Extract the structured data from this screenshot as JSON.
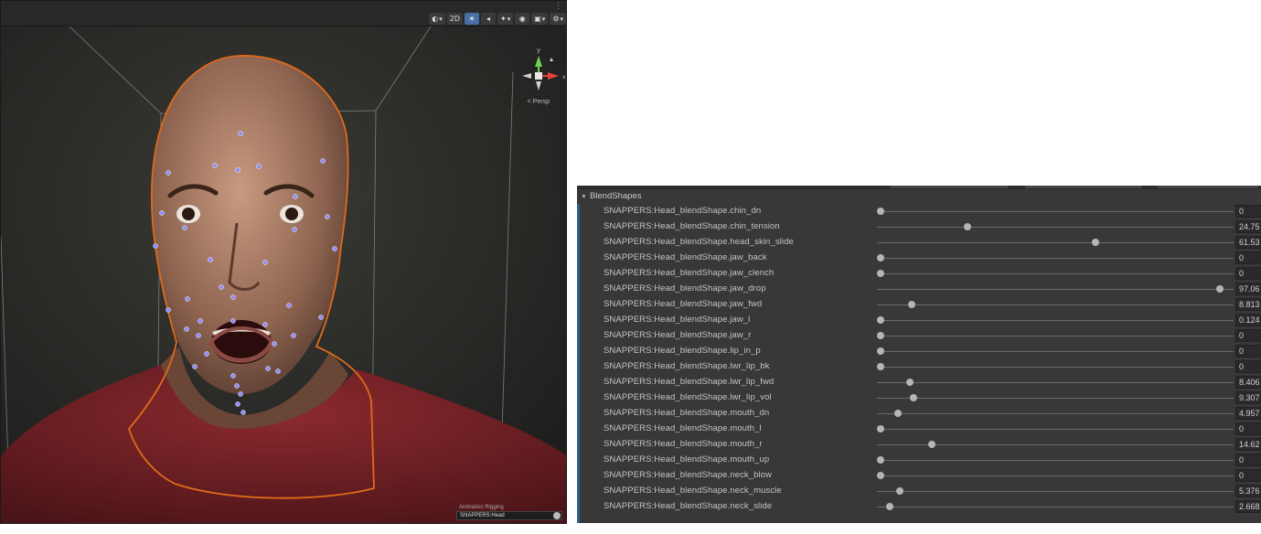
{
  "scene": {
    "toolbar": {
      "items": [
        {
          "icon": "draw-mode-icon",
          "label": "◐",
          "dropdown": true
        },
        {
          "icon": "2d-toggle",
          "label": "2D"
        },
        {
          "icon": "lighting-icon",
          "label": "☀",
          "active": true
        },
        {
          "icon": "audio-icon",
          "label": "◂"
        },
        {
          "icon": "effects-icon",
          "label": "✦",
          "dropdown": true
        },
        {
          "icon": "hidden-objects-icon",
          "label": "◉"
        },
        {
          "icon": "camera-icon",
          "label": "▣",
          "dropdown": true
        },
        {
          "icon": "gizmos-icon",
          "label": "⚙",
          "dropdown": true
        }
      ]
    },
    "gizmo_axis_x": "x",
    "projection_label": "< Persp",
    "overlay": {
      "title": "Animation Rigging",
      "field_value": "SNAPPERS:Head"
    },
    "colors": {
      "outline": "#e06a1a",
      "landmark": "#8f8cff",
      "axis_y": "#6fd14f",
      "axis_x": "#e0443a"
    }
  },
  "inspector": {
    "section_title": "BlendShapes",
    "rows": [
      {
        "label": "SNAPPERS:Head_blendShape.chin_dn",
        "value": "0",
        "fraction": 0.0
      },
      {
        "label": "SNAPPERS:Head_blendShape.chin_tension",
        "value": "24.75",
        "fraction": 0.2475
      },
      {
        "label": "SNAPPERS:Head_blendShape.head_skin_slide",
        "value": "61.53",
        "fraction": 0.6153
      },
      {
        "label": "SNAPPERS:Head_blendShape.jaw_back",
        "value": "0",
        "fraction": 0.0
      },
      {
        "label": "SNAPPERS:Head_blendShape.jaw_clench",
        "value": "0",
        "fraction": 0.0
      },
      {
        "label": "SNAPPERS:Head_blendShape.jaw_drop",
        "value": "97.06",
        "fraction": 0.9706
      },
      {
        "label": "SNAPPERS:Head_blendShape.jaw_fwd",
        "value": "8.813",
        "fraction": 0.08813
      },
      {
        "label": "SNAPPERS:Head_blendShape.jaw_l",
        "value": "0.124",
        "fraction": 0.00124
      },
      {
        "label": "SNAPPERS:Head_blendShape.jaw_r",
        "value": "0",
        "fraction": 0.0
      },
      {
        "label": "SNAPPERS:Head_blendShape.lip_in_p",
        "value": "0",
        "fraction": 0.0
      },
      {
        "label": "SNAPPERS:Head_blendShape.lwr_lip_bk",
        "value": "0",
        "fraction": 0.0
      },
      {
        "label": "SNAPPERS:Head_blendShape.lwr_lip_fwd",
        "value": "8.406",
        "fraction": 0.08406
      },
      {
        "label": "SNAPPERS:Head_blendShape.lwr_lip_vol",
        "value": "9.307",
        "fraction": 0.09307
      },
      {
        "label": "SNAPPERS:Head_blendShape.mouth_dn",
        "value": "4.957",
        "fraction": 0.04957
      },
      {
        "label": "SNAPPERS:Head_blendShape.mouth_l",
        "value": "0",
        "fraction": 0.0
      },
      {
        "label": "SNAPPERS:Head_blendShape.mouth_r",
        "value": "14.62",
        "fraction": 0.1462
      },
      {
        "label": "SNAPPERS:Head_blendShape.mouth_up",
        "value": "0",
        "fraction": 0.0
      },
      {
        "label": "SNAPPERS:Head_blendShape.neck_blow",
        "value": "0",
        "fraction": 0.0
      },
      {
        "label": "SNAPPERS:Head_blendShape.neck_muscle",
        "value": "5.376",
        "fraction": 0.05376
      },
      {
        "label": "SNAPPERS:Head_blendShape.neck_slide",
        "value": "2.668",
        "fraction": 0.02668
      }
    ]
  }
}
